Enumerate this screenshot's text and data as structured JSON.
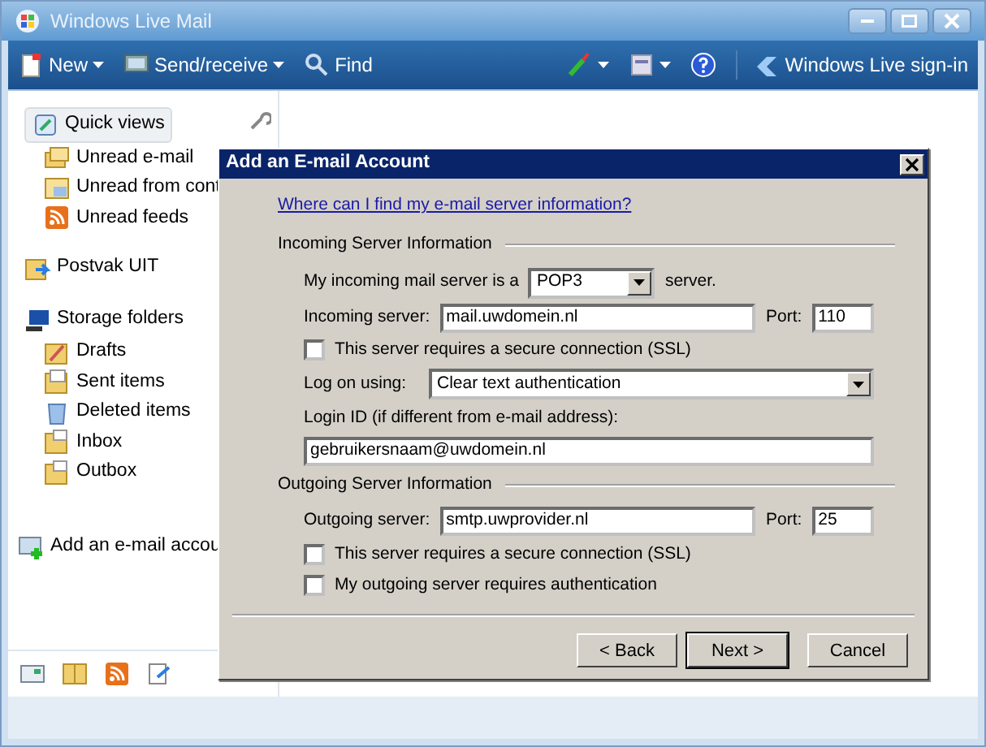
{
  "window": {
    "title": "Windows Live Mail"
  },
  "toolbar": {
    "items": [
      {
        "label": "New",
        "dropdown": true
      },
      {
        "label": "Send/receive",
        "dropdown": true
      },
      {
        "label": "Find",
        "dropdown": false
      }
    ],
    "sign_in": "Windows Live sign-in"
  },
  "sidebar": {
    "groups": [
      {
        "label": "Quick views",
        "selected": true,
        "children": [
          {
            "label": "Unread e-mail"
          },
          {
            "label": "Unread from cont"
          },
          {
            "label": "Unread feeds"
          }
        ]
      },
      {
        "label": "Postvak UIT",
        "selected": false
      },
      {
        "label": "Storage folders",
        "selected": false,
        "children": [
          {
            "label": "Drafts"
          },
          {
            "label": "Sent items"
          },
          {
            "label": "Deleted items"
          },
          {
            "label": "Inbox"
          },
          {
            "label": "Outbox"
          }
        ]
      }
    ],
    "add_account": "Add an e-mail accou"
  },
  "dialog": {
    "title": "Add an E-mail Account",
    "help_link": "Where can I find my e-mail server information?",
    "incoming": {
      "heading": "Incoming Server Information",
      "type_label": "My incoming mail server is a",
      "type_value": "POP3",
      "type_suffix": "server.",
      "server_label": "Incoming server:",
      "server_value": "mail.uwdomein.nl",
      "port_label": "Port:",
      "port_value": "110",
      "ssl_label": "This server requires a secure connection (SSL)",
      "ssl_checked": false,
      "logon_label": "Log on using:",
      "logon_value": "Clear text authentication",
      "login_label": "Login ID (if different from e-mail address):",
      "login_value": "gebruikersnaam@uwdomein.nl"
    },
    "outgoing": {
      "heading": "Outgoing Server Information",
      "server_label": "Outgoing server:",
      "server_value": "smtp.uwprovider.nl",
      "port_label": "Port:",
      "port_value": "25",
      "checks": [
        {
          "label": "This server requires a secure connection (SSL)",
          "checked": false
        },
        {
          "label": "My outgoing server requires authentication",
          "checked": false
        }
      ]
    },
    "buttons": [
      {
        "label": "< Back",
        "focused": false
      },
      {
        "label": "Next >",
        "focused": true
      },
      {
        "label": "Cancel",
        "focused": false
      }
    ]
  }
}
